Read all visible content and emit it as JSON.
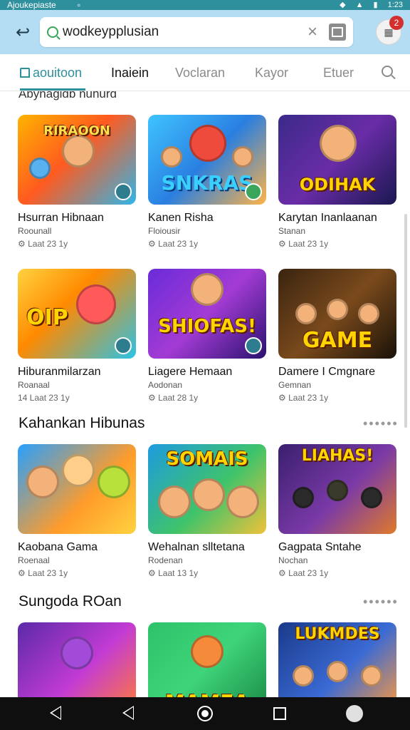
{
  "status_bar": {
    "left_text": "Ajoukepiaste",
    "right_text": "1:23"
  },
  "header": {
    "search_value": "wodkeypplusian",
    "notification_count": "2"
  },
  "tabs": [
    {
      "label": "aouitoon"
    },
    {
      "label": "Inaiein"
    },
    {
      "label": "Voclaran"
    },
    {
      "label": "Kayor"
    },
    {
      "label": "Etuer"
    }
  ],
  "colors": {
    "accent": "#2e8f9d",
    "appbar": "#b4dcf2"
  },
  "sections": [
    {
      "title": "Abyhagidb nuhurd",
      "cards": [
        {
          "title": "Hsurran Hibnaan",
          "subtitle": "Roounall",
          "meta": "⚙ Laat 23 1y",
          "art": "RIRAOON"
        },
        {
          "title": "Kanen Risha",
          "subtitle": "Floiousir",
          "meta": "⚙ Laat 23 1y",
          "art": "SNKRAS"
        },
        {
          "title": "Karytan Inanlaanan",
          "subtitle": "Stanan",
          "meta": "⚙ Laat 23 1y",
          "art": "ODIHAK"
        },
        {
          "title": "Hiburanmilarzan",
          "subtitle": "Roanaal",
          "meta": "14 Laat 23 1y",
          "art": "OIP"
        },
        {
          "title": "Liagere Hemaan",
          "subtitle": "Aodonan",
          "meta": "⚙ Laat 28 1y",
          "art": "SHIOFAS!"
        },
        {
          "title": "Damere I Cmgnare",
          "subtitle": "Gemnan",
          "meta": "⚙ Laat 23 1y",
          "art": "GAME"
        }
      ]
    },
    {
      "title": "Kahankan Hibunas",
      "cards": [
        {
          "title": "Kaobana Gama",
          "subtitle": "Roenaal",
          "meta": "⚙ Laat 23 1y",
          "art": ""
        },
        {
          "title": "Wehalnan slltetana",
          "subtitle": "Rodenan",
          "meta": "⚙ Laat 13 1y",
          "art": "SOMAIS"
        },
        {
          "title": "Gagpata Sntahe",
          "subtitle": "Nochan",
          "meta": "⚙ Laat 23 1y",
          "art": "LIAHAS!"
        }
      ]
    },
    {
      "title": "Sungoda ROan",
      "cards": [
        {
          "title": "",
          "subtitle": "",
          "meta": "",
          "art": ""
        },
        {
          "title": "",
          "subtitle": "",
          "meta": "",
          "art": "MAMEA"
        },
        {
          "title": "",
          "subtitle": "",
          "meta": "",
          "art": "LUKMDES"
        }
      ]
    }
  ]
}
